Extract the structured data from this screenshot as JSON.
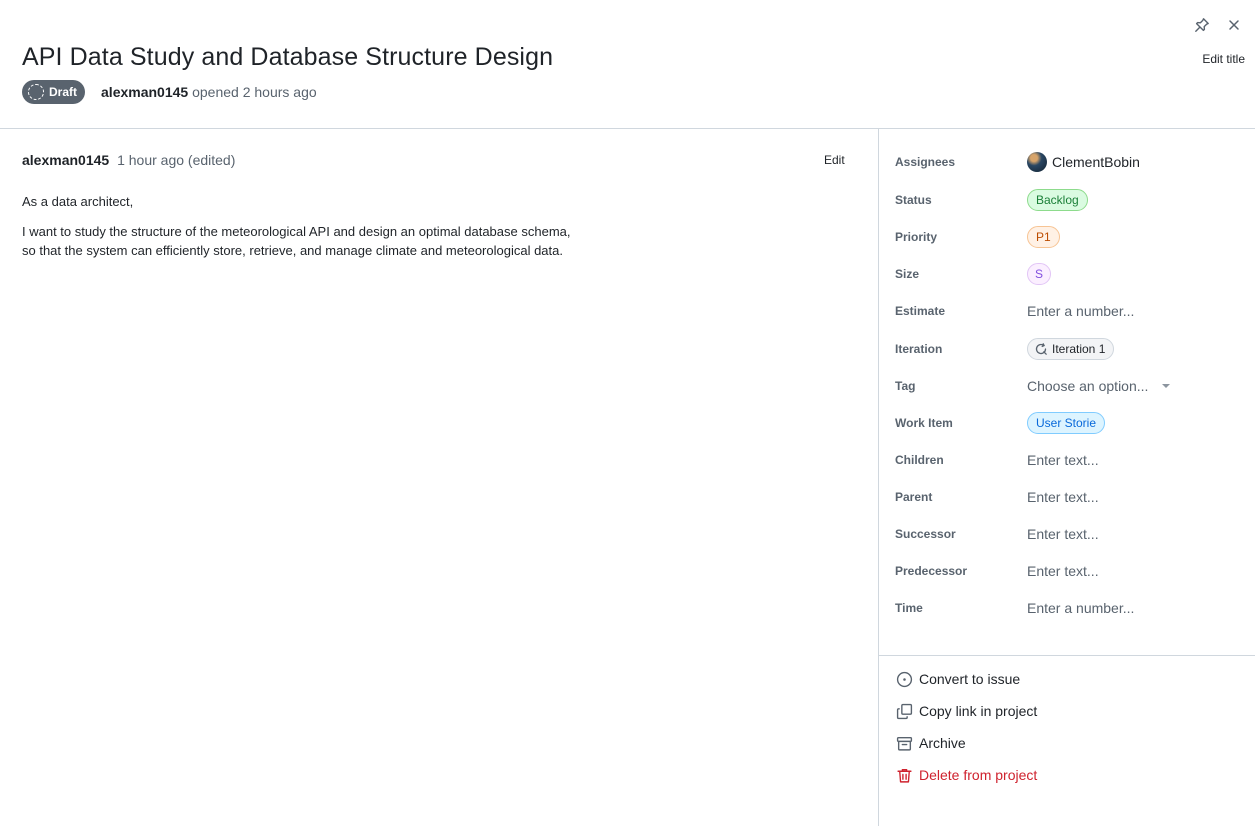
{
  "header": {
    "title": "API Data Study and Database Structure Design",
    "badge": "Draft",
    "author": "alexman0145",
    "opened_text": "opened 2 hours ago",
    "edit_title_label": "Edit title"
  },
  "comment": {
    "author": "alexman0145",
    "time": "1 hour ago (edited)",
    "edit_label": "Edit",
    "body": {
      "line1": "As a data architect,",
      "line2": "I want to study the structure of the meteorological API and design an optimal database schema,",
      "line3": "so that the system can efficiently store, retrieve, and manage climate and meteorological data."
    }
  },
  "sidebar": {
    "fields": {
      "assignees": {
        "label": "Assignees",
        "value": "ClementBobin"
      },
      "status": {
        "label": "Status",
        "value": "Backlog"
      },
      "priority": {
        "label": "Priority",
        "value": "P1"
      },
      "size": {
        "label": "Size",
        "value": "S"
      },
      "estimate": {
        "label": "Estimate",
        "value": "Enter a number..."
      },
      "iteration": {
        "label": "Iteration",
        "value": "Iteration 1"
      },
      "tag": {
        "label": "Tag",
        "value": "Choose an option..."
      },
      "work_item": {
        "label": "Work Item",
        "value": "User Storie"
      },
      "children": {
        "label": "Children",
        "value": "Enter text..."
      },
      "parent": {
        "label": "Parent",
        "value": "Enter text..."
      },
      "successor": {
        "label": "Successor",
        "value": "Enter text..."
      },
      "predecessor": {
        "label": "Predecessor",
        "value": "Enter text..."
      },
      "time": {
        "label": "Time",
        "value": "Enter a number..."
      }
    },
    "actions": {
      "convert": "Convert to issue",
      "copy_link": "Copy link in project",
      "archive": "Archive",
      "delete": "Delete from project"
    }
  },
  "icons": {
    "pin": "pin-icon",
    "close": "close-icon",
    "iteration": "iteration-icon",
    "convert": "issue-opened-icon",
    "copy": "copy-icon",
    "archive": "archive-icon",
    "delete": "trash-icon"
  },
  "colors": {
    "draft_badge": "#59636e",
    "status_green": "#1a7f37",
    "priority_orange": "#bc4c00",
    "size_purple": "#8250df",
    "work_item_blue": "#0969da",
    "danger_red": "#cf222e"
  }
}
